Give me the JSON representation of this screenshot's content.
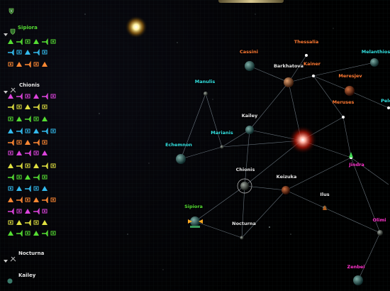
{
  "colors": {
    "planet_label_orange": "#ff7a33",
    "planet_label_cyan": "#33e0e0",
    "planet_label_white": "#e6e6e6",
    "planet_label_magenta": "#ff33cc",
    "sidebar_green": "#55dd33",
    "route_line": "#8a9aa6"
  },
  "sidebar": {
    "fleets": [
      {
        "name": "Sipiora",
        "icon": "fleet-shield-icon",
        "expanded": true
      },
      {
        "name": "Chionis",
        "icon": "fleet-swords-icon",
        "expanded": true
      },
      {
        "name": "Nocturna",
        "icon": "fleet-swords-icon",
        "expanded": false
      },
      {
        "name": "Kailey",
        "icon": "planet-icon",
        "expanded": false
      }
    ]
  },
  "planets": {
    "thessalia": "Thessalia",
    "cassini": "Cassini",
    "melanthios": "Melanthios",
    "barkhatova": "Barkhatova",
    "kainer": "Kainer",
    "manulis": "Manulis",
    "meresjev": "Meresjev",
    "meruses": "Meruses",
    "pele": "Pele",
    "kailey": "Kailey",
    "marianis": "Marianis",
    "echemnon": "Echemnon",
    "jindra": "Jindra",
    "chionis": "Chionis",
    "keizuka": "Keizuka",
    "ilus": "Ilus",
    "sipiora": "Sipiora",
    "nocturna": "Nocturna",
    "olimi": "Olimi",
    "zenbei": "Zenbei"
  }
}
